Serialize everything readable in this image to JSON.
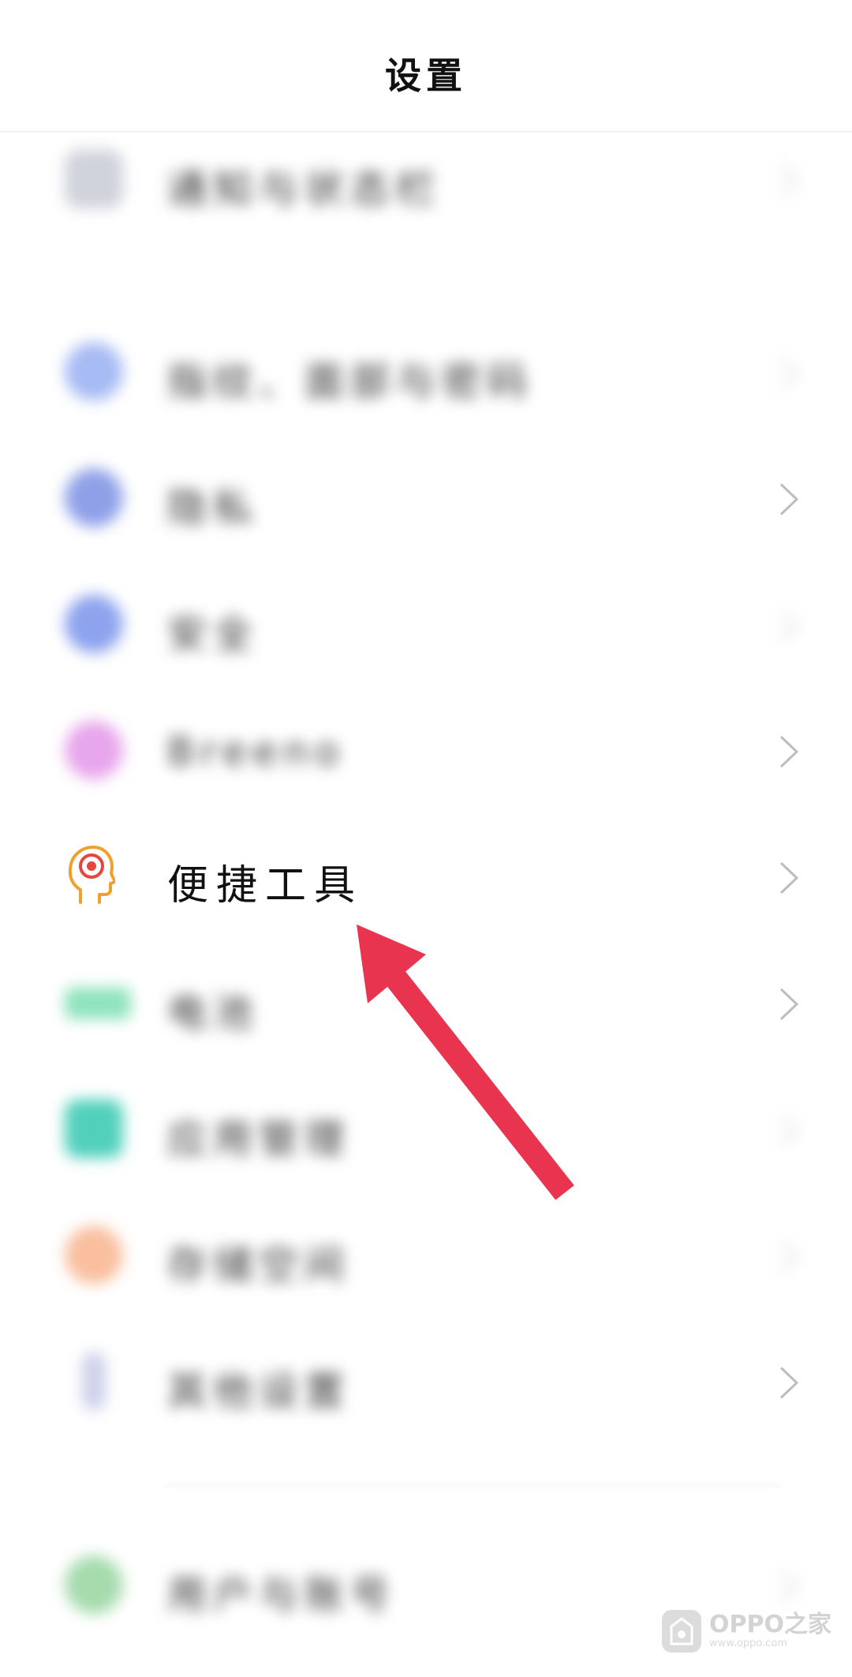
{
  "header": {
    "title": "设置"
  },
  "rows": [
    {
      "label": "通知与状态栏",
      "icon_color": "#c9cbd8",
      "icon": "bell-icon"
    },
    {
      "label": "指纹、面部与密码",
      "icon_color": "#9fb4f2",
      "icon": "fingerprint-icon"
    },
    {
      "label": "隐私",
      "icon_color": "#8e9fe6",
      "icon": "privacy-icon"
    },
    {
      "label": "安全",
      "icon_color": "#8aa1ee",
      "icon": "shield-icon"
    },
    {
      "label": "Breeno",
      "icon_color": "#e7a2ea",
      "icon": "breeno-icon"
    },
    {
      "label": "便捷工具",
      "icon_color": "#f0a535",
      "icon": "head-target-icon"
    },
    {
      "label": "电池",
      "icon_color": "#86e0b8",
      "icon": "battery-icon"
    },
    {
      "label": "应用管理",
      "icon_color": "#4fd0bd",
      "icon": "app-management-icon"
    },
    {
      "label": "存储空间",
      "icon_color": "#f8b89a",
      "icon": "storage-icon"
    },
    {
      "label": "其他设置",
      "icon_color": "#c7cbe8",
      "icon": "other-settings-icon"
    },
    {
      "label": "用户与账号",
      "icon_color": "#9fd8a8",
      "icon": "user-account-icon"
    }
  ],
  "arrow": {
    "color": "#e8344e",
    "icon": "arrow-icon"
  },
  "watermark": {
    "brand": "OPPO之家",
    "url": "www.oppo.com"
  }
}
